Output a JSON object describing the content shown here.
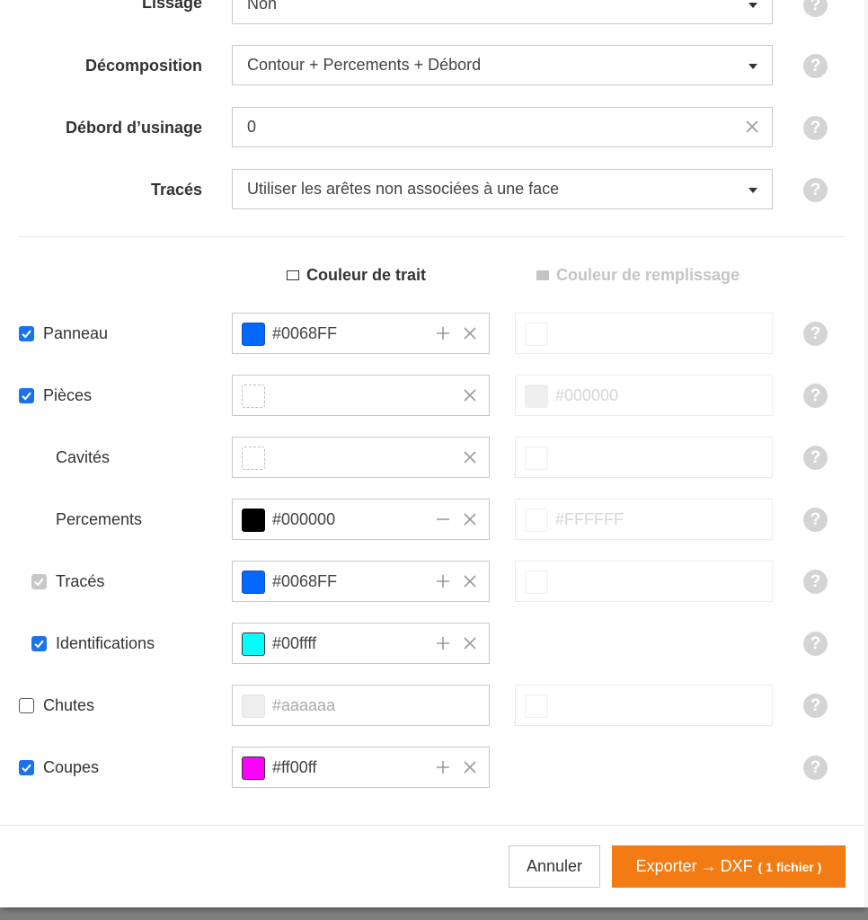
{
  "settings": {
    "lissage": {
      "label": "Lissage",
      "value": "Non"
    },
    "decomposition": {
      "label": "Décomposition",
      "value": "Contour + Percements + Débord"
    },
    "debord": {
      "label": "Débord d’usinage",
      "value": "0"
    },
    "traces": {
      "label": "Tracés",
      "value": "Utiliser les arêtes non associées à une face"
    }
  },
  "columns": {
    "stroke": "Couleur de trait",
    "fill": "Couleur de remplissage"
  },
  "help_glyph": "?",
  "layers": [
    {
      "label": "Panneau",
      "checkbox": "checked",
      "stroke": {
        "color": "#0068FF",
        "text": "#0068FF",
        "action": "plus"
      },
      "fill": {
        "text": ""
      }
    },
    {
      "label": "Pièces",
      "checkbox": "checked",
      "stroke": {
        "color": "",
        "text": "",
        "action": ""
      },
      "fill": {
        "text": "#000000"
      }
    },
    {
      "label": "Cavités",
      "checkbox": "none",
      "stroke": {
        "color": "",
        "text": "",
        "action": ""
      },
      "fill": {
        "text": ""
      }
    },
    {
      "label": "Percements",
      "checkbox": "none",
      "stroke": {
        "color": "#000000",
        "text": "#000000",
        "action": "minus"
      },
      "fill": {
        "text": "#FFFFFF"
      }
    },
    {
      "label": "Tracés",
      "checkbox": "disabled",
      "stroke": {
        "color": "#0068FF",
        "text": "#0068FF",
        "action": "plus"
      },
      "fill": {
        "text": ""
      }
    },
    {
      "label": "Identifications",
      "checkbox": "checked",
      "stroke": {
        "color": "#00ffff",
        "text": "#00ffff",
        "action": "plus"
      }
    },
    {
      "label": "Chutes",
      "checkbox": "unchecked",
      "stroke": {
        "color": "#eeeeee",
        "text": "#aaaaaa",
        "action": ""
      },
      "fill": {
        "text": ""
      }
    },
    {
      "label": "Coupes",
      "checkbox": "checked",
      "stroke": {
        "color": "#ff00ff",
        "text": "#ff00ff",
        "action": "plus"
      }
    }
  ],
  "footer": {
    "cancel": "Annuler",
    "export_prefix": "Exporter",
    "export_arrow": "→",
    "export_format": "DXF",
    "export_count": "( 1 fichier )"
  },
  "colors": {
    "accent": "#1a73e8",
    "export": "#f27c13",
    "help": "#d4d4d4"
  }
}
